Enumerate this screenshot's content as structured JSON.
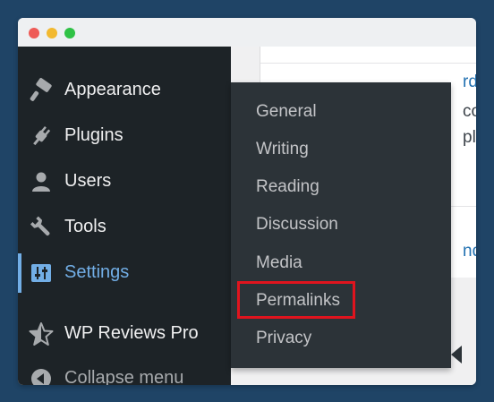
{
  "sidebar": {
    "items": [
      {
        "label": "Appearance",
        "icon": "paintbrush-icon"
      },
      {
        "label": "Plugins",
        "icon": "plug-icon"
      },
      {
        "label": "Users",
        "icon": "user-icon"
      },
      {
        "label": "Tools",
        "icon": "wrench-icon"
      },
      {
        "label": "Settings",
        "icon": "sliders-icon",
        "active": true
      },
      {
        "label": "WP Reviews Pro",
        "icon": "star-icon"
      },
      {
        "label": "Collapse menu",
        "icon": "collapse-arrow-icon"
      }
    ]
  },
  "flyout": {
    "items": [
      {
        "label": "General"
      },
      {
        "label": "Writing"
      },
      {
        "label": "Reading"
      },
      {
        "label": "Discussion"
      },
      {
        "label": "Media"
      },
      {
        "label": "Permalinks",
        "highlighted": true
      },
      {
        "label": "Privacy"
      }
    ]
  },
  "background_content": {
    "fragments": [
      "rdP",
      "con",
      "ple",
      "ndi"
    ]
  },
  "colors": {
    "page_background": "#1f4466",
    "sidebar": "#1d2327",
    "flyout": "#2c3338",
    "active": "#72aee6",
    "highlight": "#e0141e"
  }
}
